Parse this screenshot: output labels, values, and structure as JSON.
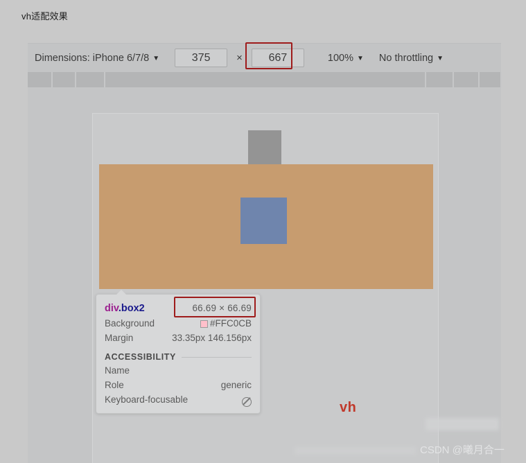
{
  "page": {
    "title": "vh适配效果"
  },
  "device_toolbar": {
    "dimensions_label": "Dimensions: iPhone 6/7/8",
    "dimensions_caret": "▼",
    "width_value": "375",
    "times_symbol": "×",
    "height_value": "667",
    "zoom_value": "100%",
    "zoom_caret": "▼",
    "throttling_value": "No throttling",
    "throttling_caret": "▼",
    "height_highlight_color": "#9e1b1b"
  },
  "ruler": {
    "tick_positions": [
      34,
      68,
      110,
      573,
      613,
      650,
      682
    ]
  },
  "rendered_page": {
    "gray_box_color": "#949494",
    "tan_box_color": "#c79c6f",
    "blue_box_color": "#6f85ad",
    "page_background": "#c9cacb"
  },
  "annotation": {
    "vh_label": "vh",
    "vh_color": "#c0392b"
  },
  "inspector_tooltip": {
    "selector_tag": "div",
    "selector_class": ".box2",
    "size": "66.69 × 66.69",
    "size_highlight_color": "#9e1b1b",
    "rows": [
      {
        "key": "Background",
        "value": "#FFC0CB",
        "swatch": "#ffc0cb"
      },
      {
        "key": "Margin",
        "value": "33.35px 146.156px"
      }
    ],
    "accessibility_section_title": "ACCESSIBILITY",
    "accessibility_rows": [
      {
        "key": "Name",
        "value": ""
      },
      {
        "key": "Role",
        "value": "generic"
      },
      {
        "key": "Keyboard-focusable",
        "value": "",
        "icon": "not-allowed-icon"
      }
    ]
  },
  "watermark": {
    "text": "CSDN @曦月合一"
  }
}
